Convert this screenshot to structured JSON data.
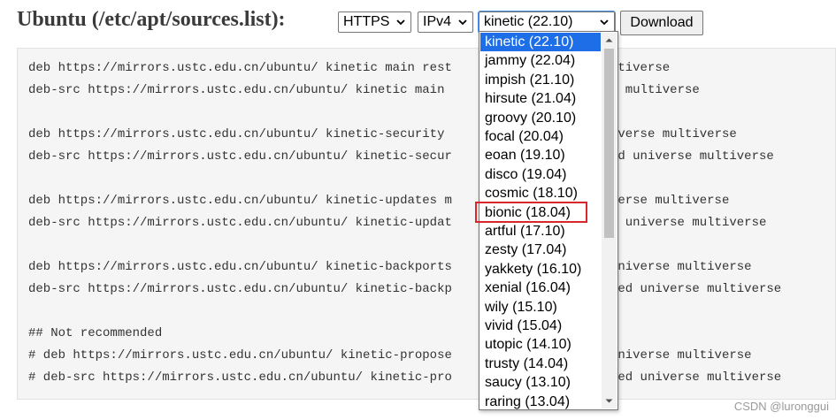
{
  "heading": "Ubuntu (/etc/apt/sources.list):",
  "controls": {
    "protocol": "HTTPS",
    "ip": "IPv4",
    "release": "kinetic (22.10)",
    "download_label": "Download"
  },
  "code_lines": [
    "deb https://mirrors.ustc.edu.cn/ubuntu/ kinetic main rest",
    "deb-src https://mirrors.ustc.edu.cn/ubuntu/ kinetic main",
    "",
    "deb https://mirrors.ustc.edu.cn/ubuntu/ kinetic-security",
    "deb-src https://mirrors.ustc.edu.cn/ubuntu/ kinetic-secur",
    "",
    "deb https://mirrors.ustc.edu.cn/ubuntu/ kinetic-updates m",
    "deb-src https://mirrors.ustc.edu.cn/ubuntu/ kinetic-updat",
    "",
    "deb https://mirrors.ustc.edu.cn/ubuntu/ kinetic-backports",
    "deb-src https://mirrors.ustc.edu.cn/ubuntu/ kinetic-backp",
    "",
    "## Not recommended",
    "# deb https://mirrors.ustc.edu.cn/ubuntu/ kinetic-propose",
    "# deb-src https://mirrors.ustc.edu.cn/ubuntu/ kinetic-pro"
  ],
  "code_line_tails": [
    "ltiverse",
    "e multiverse",
    "",
    "iverse multiverse",
    "ed universe multiverse",
    "",
    "verse multiverse",
    "l universe multiverse",
    "",
    "universe multiverse",
    "ted universe multiverse",
    "",
    "",
    "universe multiverse",
    "ted universe multiverse"
  ],
  "release_options": [
    "kinetic (22.10)",
    "jammy (22.04)",
    "impish (21.10)",
    "hirsute (21.04)",
    "groovy (20.10)",
    "focal (20.04)",
    "eoan (19.10)",
    "disco (19.04)",
    "cosmic (18.10)",
    "bionic (18.04)",
    "artful (17.10)",
    "zesty (17.04)",
    "yakkety (16.10)",
    "xenial (16.04)",
    "wily (15.10)",
    "vivid (15.04)",
    "utopic (14.10)",
    "trusty (14.04)",
    "saucy (13.10)",
    "raring (13.04)"
  ],
  "selected_release_index": 0,
  "highlighted_release_index": 9,
  "watermark": "CSDN @luronggui",
  "colors": {
    "selection": "#1e6ee8",
    "highlight": "#d9262c",
    "code_bg": "#f5f5f5"
  },
  "icons": [
    "chevron-down-icon",
    "scroll-up-arrow-icon",
    "scroll-down-arrow-icon"
  ]
}
